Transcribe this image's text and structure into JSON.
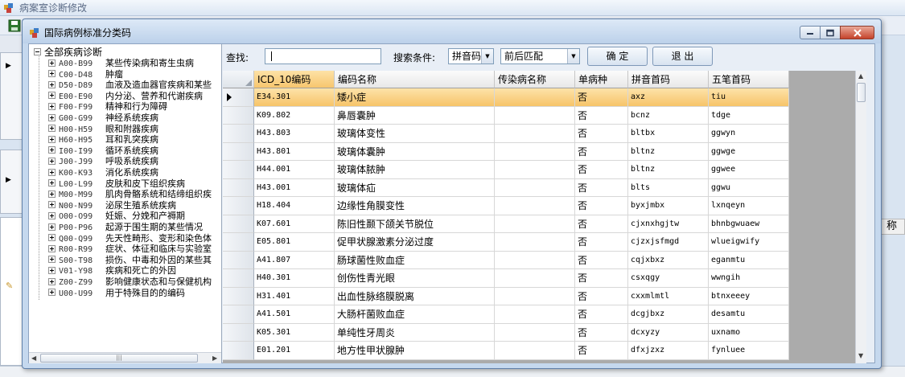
{
  "parent_window": {
    "title": "病案室诊断修改",
    "right_column_label": "称"
  },
  "dialog": {
    "title": "国际病例标准分类码",
    "controls": {
      "minimize": "minimize-icon",
      "maximize": "maximize-icon",
      "close": "close-icon"
    }
  },
  "search": {
    "find_label": "查找:",
    "find_value": "",
    "condition_label": "搜索条件:",
    "condition_value": "拼音码",
    "match_value": "前后匹配",
    "confirm_label": "确 定",
    "exit_label": "退 出"
  },
  "tree": {
    "root": "全部疾病诊断",
    "nodes": [
      {
        "code": "A00-B99",
        "name": "某些传染病和寄生虫病"
      },
      {
        "code": "C00-D48",
        "name": "肿瘤"
      },
      {
        "code": "D50-D89",
        "name": "血液及造血器官疾病和某些"
      },
      {
        "code": "E00-E90",
        "name": "内分泌、营养和代谢疾病"
      },
      {
        "code": "F00-F99",
        "name": "精神和行为障碍"
      },
      {
        "code": "G00-G99",
        "name": "神经系统疾病"
      },
      {
        "code": "H00-H59",
        "name": "眼和附器疾病"
      },
      {
        "code": "H60-H95",
        "name": "耳和乳突疾病"
      },
      {
        "code": "I00-I99",
        "name": "循环系统疾病"
      },
      {
        "code": "J00-J99",
        "name": "呼吸系统疾病"
      },
      {
        "code": "K00-K93",
        "name": "消化系统疾病"
      },
      {
        "code": "L00-L99",
        "name": "皮肤和皮下组织疾病"
      },
      {
        "code": "M00-M99",
        "name": "肌肉骨骼系统和结缔组织疾"
      },
      {
        "code": "N00-N99",
        "name": "泌尿生殖系统疾病"
      },
      {
        "code": "O00-O99",
        "name": "妊娠、分娩和产褥期"
      },
      {
        "code": "P00-P96",
        "name": "起源于围生期的某些情况"
      },
      {
        "code": "Q00-Q99",
        "name": "先天性畸形、变形和染色体"
      },
      {
        "code": "R00-R99",
        "name": "症状、体征和临床与实验室"
      },
      {
        "code": "S00-T98",
        "name": "损伤、中毒和外因的某些其"
      },
      {
        "code": "V01-Y98",
        "name": "疾病和死亡的外因"
      },
      {
        "code": "Z00-Z99",
        "name": "影响健康状态和与保健机构"
      },
      {
        "code": "U00-U99",
        "name": "用于特殊目的的编码"
      }
    ]
  },
  "grid": {
    "columns": [
      "ICD_10编码",
      "编码名称",
      "传染病名称",
      "单病种",
      "拼音首码",
      "五笔首码"
    ],
    "rows": [
      {
        "code": "E34.301",
        "name": "矮小症",
        "infect": "",
        "single": "否",
        "py": "axz",
        "wb": "tiu"
      },
      {
        "code": "K09.802",
        "name": "鼻唇囊肿",
        "infect": "",
        "single": "否",
        "py": "bcnz",
        "wb": "tdge"
      },
      {
        "code": "H43.803",
        "name": "玻璃体变性",
        "infect": "",
        "single": "否",
        "py": "bltbx",
        "wb": "ggwyn"
      },
      {
        "code": "H43.801",
        "name": "玻璃体囊肿",
        "infect": "",
        "single": "否",
        "py": "bltnz",
        "wb": "ggwge"
      },
      {
        "code": "H44.001",
        "name": "玻璃体脓肿",
        "infect": "",
        "single": "否",
        "py": "bltnz",
        "wb": "ggwee"
      },
      {
        "code": "H43.001",
        "name": "玻璃体疝",
        "infect": "",
        "single": "否",
        "py": "blts",
        "wb": "ggwu"
      },
      {
        "code": "H18.404",
        "name": "边缘性角膜变性",
        "infect": "",
        "single": "否",
        "py": "byxjmbx",
        "wb": "lxnqeyn"
      },
      {
        "code": "K07.601",
        "name": "陈旧性颞下颌关节脱位",
        "infect": "",
        "single": "否",
        "py": "cjxnxhgjtw",
        "wb": "bhnbgwuaew"
      },
      {
        "code": "E05.801",
        "name": "促甲状腺激素分泌过度",
        "infect": "",
        "single": "否",
        "py": "cjzxjsfmgd",
        "wb": "wlueigwify"
      },
      {
        "code": "A41.807",
        "name": "肠球菌性败血症",
        "infect": "",
        "single": "否",
        "py": "cqjxbxz",
        "wb": "eganmtu"
      },
      {
        "code": "H40.301",
        "name": "创伤性青光眼",
        "infect": "",
        "single": "否",
        "py": "csxqgy",
        "wb": "wwngih"
      },
      {
        "code": "H31.401",
        "name": "出血性脉络膜脱离",
        "infect": "",
        "single": "否",
        "py": "cxxmlmtl",
        "wb": "btnxeeey"
      },
      {
        "code": "A41.501",
        "name": "大肠杆菌败血症",
        "infect": "",
        "single": "否",
        "py": "dcgjbxz",
        "wb": "desamtu"
      },
      {
        "code": "K05.301",
        "name": "单纯性牙周炎",
        "infect": "",
        "single": "否",
        "py": "dcxyzy",
        "wb": "uxnamo"
      },
      {
        "code": "E01.201",
        "name": "地方性甲状腺肿",
        "infect": "",
        "single": "否",
        "py": "dfxjzxz",
        "wb": "fynluee"
      }
    ]
  }
}
